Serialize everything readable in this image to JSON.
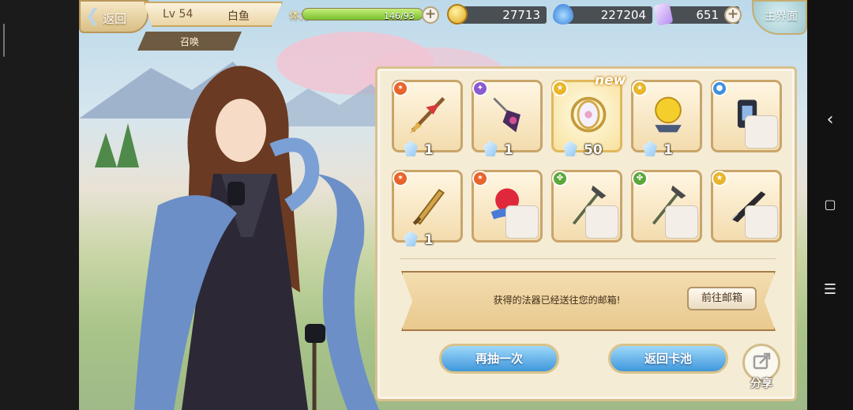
{
  "header": {
    "back_label": "返回",
    "level": "Lv 54",
    "player_name": "白鱼",
    "summon_tab": "召唤",
    "stamina_label": "体力",
    "stamina_text": "146/93",
    "stamina_fraction": 1.0,
    "home_label": "主界面"
  },
  "resources": {
    "gold": "27713",
    "crystal": "227204",
    "gem": "651"
  },
  "rewards": [
    {
      "item": "red-ribbon-spear",
      "rarity": "orange",
      "count": "1",
      "is_new": false,
      "has_portrait": false
    },
    {
      "item": "purple-pendulum",
      "rarity": "purple",
      "count": "1",
      "is_new": false,
      "has_portrait": false
    },
    {
      "item": "golden-mirror-compass",
      "rarity": "gold",
      "count": "50",
      "is_new": true,
      "new_label": "new",
      "has_portrait": false
    },
    {
      "item": "golden-crystal-orb",
      "rarity": "gold",
      "count": "1",
      "is_new": false,
      "has_portrait": false
    },
    {
      "item": "dark-lantern",
      "rarity": "blue",
      "count": "",
      "is_new": false,
      "has_portrait": true
    },
    {
      "item": "bronze-dagger",
      "rarity": "orange",
      "count": "1",
      "is_new": false,
      "has_portrait": false
    },
    {
      "item": "ruby-heart-jewel",
      "rarity": "orange",
      "count": "",
      "is_new": false,
      "has_portrait": true
    },
    {
      "item": "claw-staff",
      "rarity": "green",
      "count": "",
      "is_new": false,
      "has_portrait": true
    },
    {
      "item": "claw-staff",
      "rarity": "green",
      "count": "",
      "is_new": false,
      "has_portrait": true
    },
    {
      "item": "black-knife",
      "rarity": "gold",
      "count": "",
      "is_new": false,
      "has_portrait": true
    }
  ],
  "notice": {
    "message": "获得的法器已经送往您的邮箱!",
    "mail_button": "前往邮箱"
  },
  "actions": {
    "draw_again": "再抽一次",
    "back_to_pool": "返回卡池",
    "share": "分享"
  },
  "colors": {
    "orange": "#e8642a",
    "purple": "#8a5bd0",
    "gold": "#e9b52a",
    "blue": "#3f8fe0",
    "green": "#5ca83a"
  }
}
